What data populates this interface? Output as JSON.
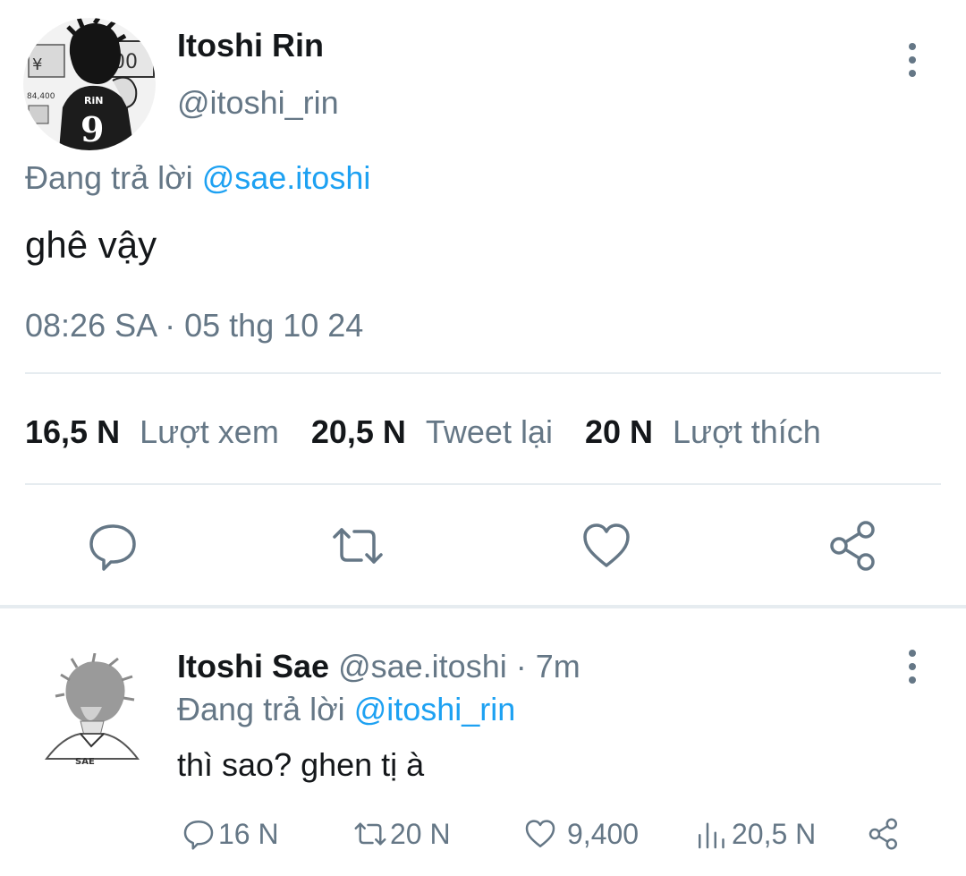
{
  "main_tweet": {
    "display_name": "Itoshi Rin",
    "handle": "@itoshi_rin",
    "replying_prefix": "Đang trả lời",
    "replying_to": "@sae.itoshi",
    "text": "ghê vậy",
    "timestamp": "08:26 SA · 05 thg 10 24",
    "stats": {
      "views_count": "16,5 N",
      "views_label": "Lượt xem",
      "retweets_count": "20,5 N",
      "retweets_label": "Tweet lại",
      "likes_count": "20 N",
      "likes_label": "Lượt thích"
    },
    "actions": [
      "reply-icon",
      "retweet-icon",
      "heart-icon",
      "share-icon"
    ]
  },
  "reply_tweet": {
    "display_name": "Itoshi Sae",
    "handle": "@sae.itoshi",
    "time_ago": "· 7m",
    "replying_prefix": "Đang trả lời",
    "replying_to": "@itoshi_rin",
    "text": "thì sao? ghen tị à",
    "actions": {
      "reply_count": "16 N",
      "retweet_count": "20 N",
      "like_count": "9,400",
      "views_count": "20,5 N"
    }
  },
  "colors": {
    "text_primary": "#14171a",
    "text_secondary": "#657786",
    "accent": "#1da1f2",
    "divider": "#e6ecf0"
  }
}
